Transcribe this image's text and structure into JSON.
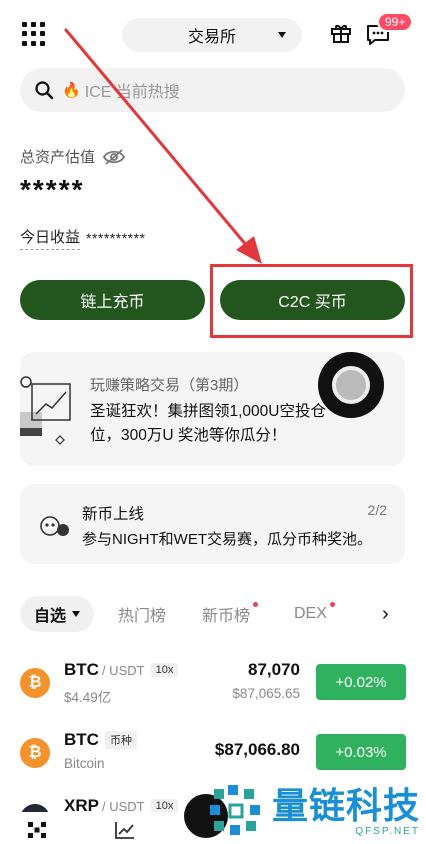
{
  "header": {
    "exchange_label": "交易所",
    "badge_count": "99+"
  },
  "search": {
    "placeholder": "ICE 当前热搜"
  },
  "assets": {
    "label": "总资产估值",
    "value": "*****",
    "today_label": "今日收益",
    "today_value": "**********"
  },
  "actions": {
    "deposit": "链上充币",
    "c2c": "C2C 买币"
  },
  "promo1": {
    "title": "玩赚策略交易（第3期）",
    "desc": "圣诞狂欢！集拼图领1,000U空投仓位，300万U 奖池等你瓜分！"
  },
  "promo2": {
    "title": "新币上线",
    "desc": "参与NIGHT和WET交易赛，瓜分币种奖池。",
    "pager": "2/2"
  },
  "tabs": {
    "favorites": "自选",
    "hot": "热门榜",
    "new": "新币榜",
    "dex": "DEX",
    "more": "›"
  },
  "market": [
    {
      "coin": "₿",
      "name": "BTC",
      "quote": "/ USDT",
      "tag": "10x",
      "sub": "$4.49亿",
      "price": "87,070",
      "price_sub": "$87,065.65",
      "change": "+0.02%"
    },
    {
      "coin": "₿",
      "name": "BTC",
      "quote": "",
      "tag": "币种",
      "sub": "Bitcoin",
      "price": "$87,066.80",
      "price_sub": "",
      "change": "+0.03%"
    },
    {
      "coin": "✕",
      "name": "XRP",
      "quote": "/ USDT",
      "tag": "10x"
    }
  ],
  "watermark": {
    "big": "量链科技",
    "small": "QFSP.NET"
  },
  "colors": {
    "accent_green": "#22561c",
    "up_green": "#2fb15e",
    "annotation_red": "#e2383d",
    "badge_red": "#ff4b66"
  }
}
